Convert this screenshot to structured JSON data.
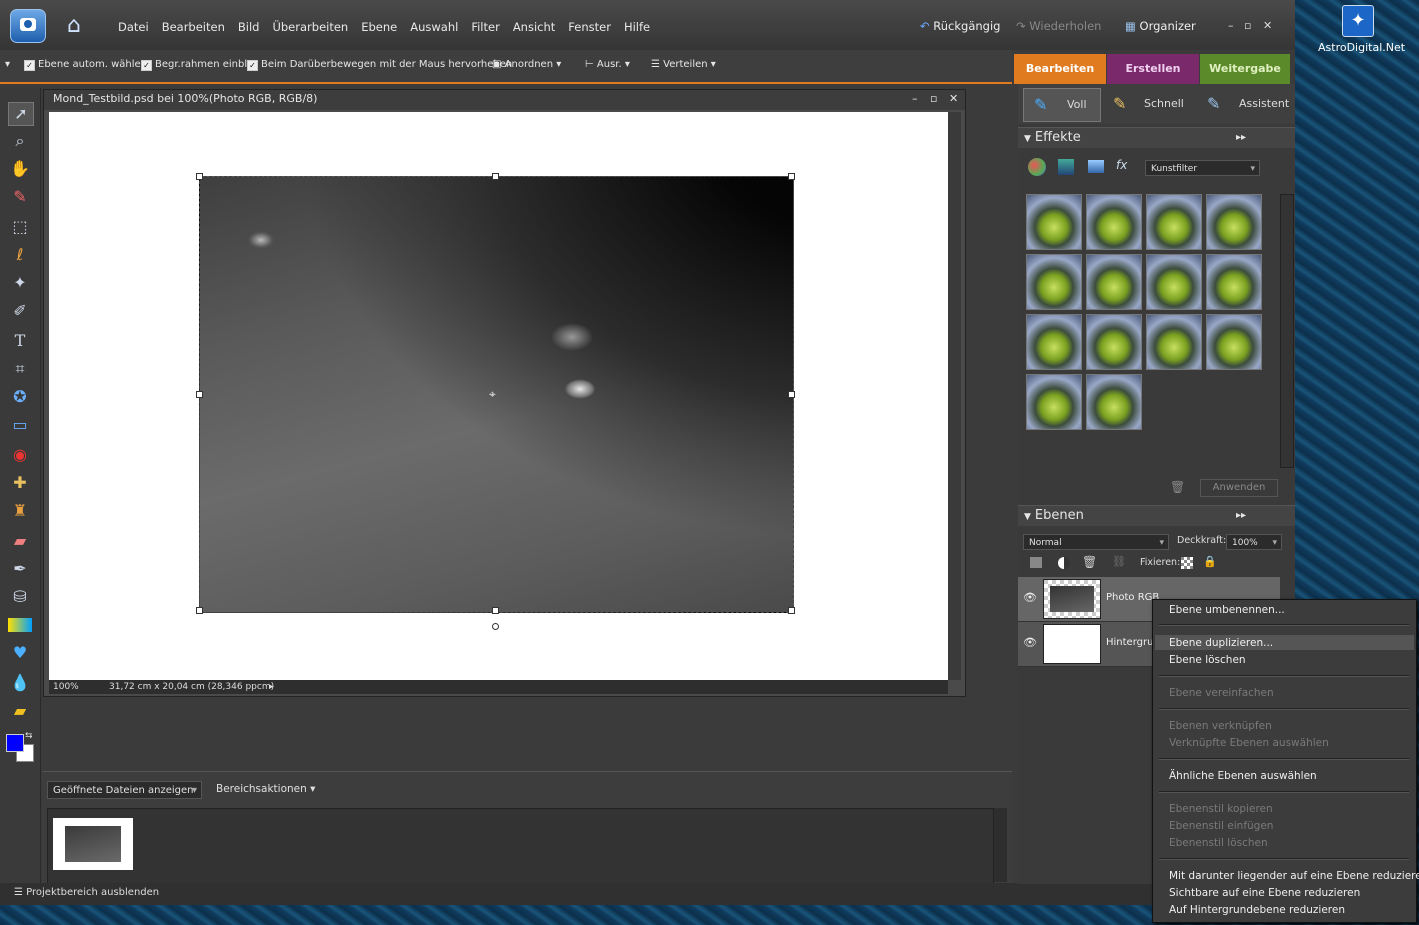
{
  "menubar": {
    "items": [
      "Datei",
      "Bearbeiten",
      "Bild",
      "Überarbeiten",
      "Ebene",
      "Auswahl",
      "Filter",
      "Ansicht",
      "Fenster",
      "Hilfe"
    ],
    "undo": "Rückgängig",
    "redo": "Wiederholen",
    "organizer": "Organizer"
  },
  "options": {
    "auto_select": "Ebene autom. wählen",
    "bounding": "Begr.rahmen einbl.",
    "hover": "Beim Darüberbewegen mit der Maus hervorheben",
    "arrange": "Anordnen",
    "align": "Ausr.",
    "distribute": "Verteilen"
  },
  "mode_tabs": {
    "edit": "Bearbeiten",
    "create": "Erstellen",
    "share": "Weitergabe"
  },
  "edit_modes": {
    "full": "Voll",
    "quick": "Schnell",
    "guided": "Assistent"
  },
  "document": {
    "title": "Mond_Testbild.psd bei 100%(Photo RGB, RGB/8)",
    "zoom": "100%",
    "size": "31,72 cm x 20,04 cm (28,346 ppcm)"
  },
  "effects": {
    "header": "Effekte",
    "filter_select": "Kunstfilter",
    "apply": "Anwenden"
  },
  "layers": {
    "header": "Ebenen",
    "blend": "Normal",
    "opacity_label": "Deckkraft:",
    "opacity": "100%",
    "lock_label": "Fixieren:",
    "rows": [
      "Photo RGB",
      "Hintergru"
    ]
  },
  "project": {
    "show_files": "Geöffnete Dateien anzeigen",
    "area_actions": "Bereichsaktionen",
    "hide": "Projektbereich ausblenden"
  },
  "context_menu": {
    "rename": "Ebene umbenennen...",
    "duplicate": "Ebene duplizieren...",
    "delete": "Ebene löschen",
    "simplify": "Ebene vereinfachen",
    "link": "Ebenen verknüpfen",
    "select_linked": "Verknüpfte Ebenen auswählen",
    "select_similar": "Ähnliche Ebenen auswählen",
    "copy_style": "Ebenenstil kopieren",
    "paste_style": "Ebenenstil einfügen",
    "clear_style": "Ebenenstil löschen",
    "merge_down": "Mit darunter liegender auf eine Ebene reduzieren",
    "merge_visible": "Sichtbare auf eine Ebene reduzieren",
    "flatten": "Auf Hintergrundebene reduzieren"
  },
  "desktop": {
    "icon_label": "AstroDigital.Net"
  },
  "colors": {
    "accent": "#e07b20",
    "create": "#7a2a6a",
    "share": "#5a8a2a",
    "foreground": "#0000ff",
    "background": "#ffffff"
  }
}
